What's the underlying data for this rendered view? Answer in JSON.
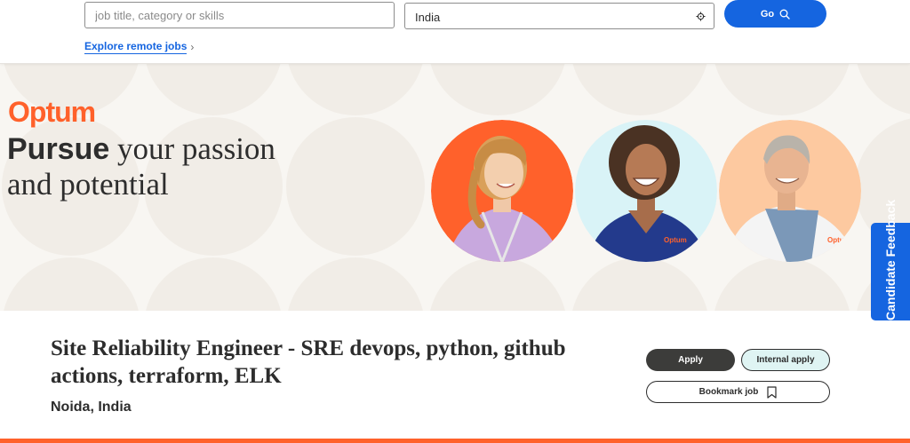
{
  "search": {
    "keyword_placeholder": "job title, category or skills",
    "keyword_value": "",
    "location_value": "India",
    "go_label": "Go",
    "remote_link_label": "Explore remote jobs"
  },
  "hero": {
    "brand": "Optum",
    "headline_strong": "Pursue",
    "headline_rest_line1": " your passion",
    "headline_line2": "and potential",
    "portraits": [
      {
        "name": "portrait-woman-lanyard",
        "bg": "#ff612b"
      },
      {
        "name": "portrait-woman-scrubs",
        "bg": "#d9f3f7"
      },
      {
        "name": "portrait-man-labcoat",
        "bg": "#fdc9a0"
      }
    ],
    "badge_text": "Optum"
  },
  "feedback_tab": {
    "label": "Candidate Feedback"
  },
  "job": {
    "title": "Site Reliability Engineer - SRE devops, python, github actions, terraform, ELK",
    "location": "Noida, India",
    "apply_label": "Apply",
    "internal_apply_label": "Internal apply",
    "bookmark_label": "Bookmark job"
  },
  "colors": {
    "brand_orange": "#ff612b",
    "action_blue": "#1565e0",
    "dark_button": "#3c3c3a",
    "internal_button_bg": "#dff4f3",
    "hero_bg": "#f8f6f2"
  }
}
